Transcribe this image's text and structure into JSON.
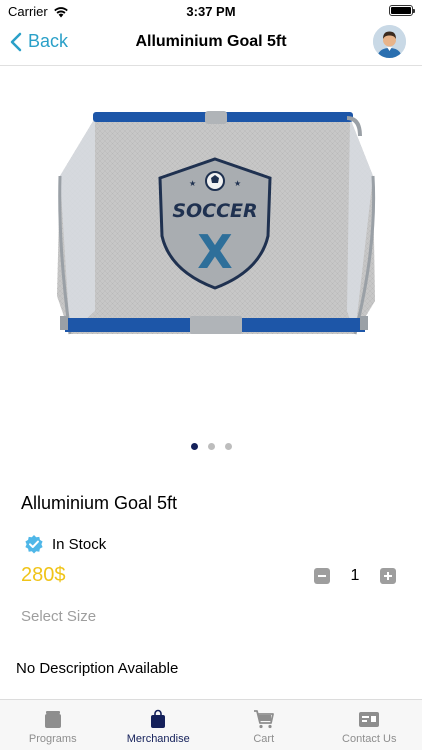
{
  "status_bar": {
    "carrier": "Carrier",
    "time": "3:37 PM"
  },
  "nav": {
    "back_label": "Back",
    "title": "Alluminium Goal 5ft"
  },
  "product": {
    "image_logo_text": "SOCCER",
    "image_logo_letter": "X",
    "carousel": {
      "pages": 3,
      "active": 1
    },
    "title": "Alluminium Goal 5ft",
    "stock_label": "In Stock",
    "price": "280$",
    "quantity": "1",
    "select_size_label": "Select Size",
    "description": "No Description Available"
  },
  "tabs": [
    {
      "label": "Programs",
      "icon": "programs-icon",
      "active": false
    },
    {
      "label": "Merchandise",
      "icon": "shopping-bag-icon",
      "active": true
    },
    {
      "label": "Cart",
      "icon": "cart-icon",
      "active": false
    },
    {
      "label": "Contact Us",
      "icon": "contact-card-icon",
      "active": false
    }
  ],
  "colors": {
    "accent": "#2aa0c8",
    "price": "#f0c419",
    "active_tab": "#14205a",
    "inactive_tab": "#8e8e8e",
    "stock_badge": "#4fb7e8"
  }
}
